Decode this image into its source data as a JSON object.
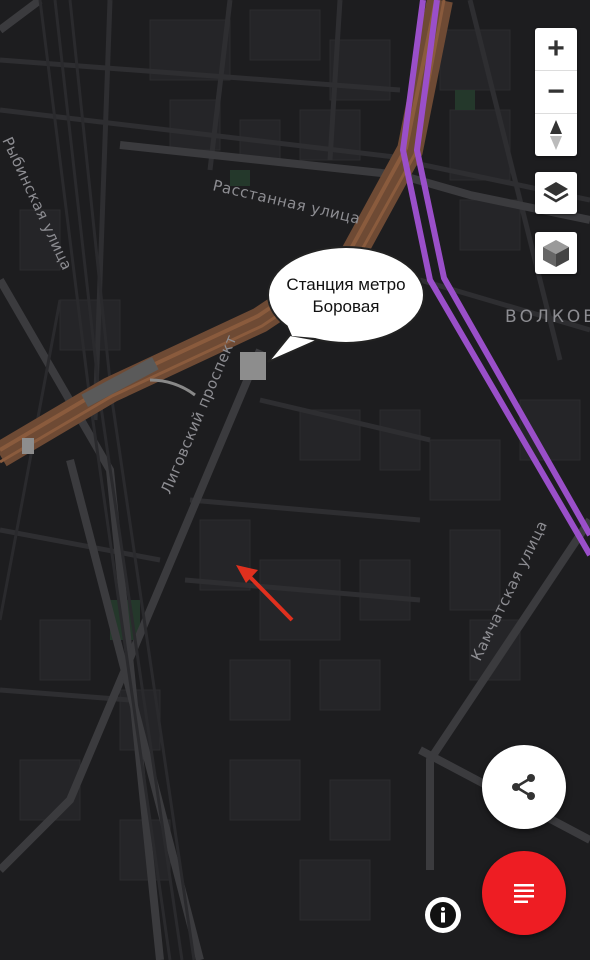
{
  "map": {
    "callout": {
      "line1": "Станция метро",
      "line2": "Боровая"
    },
    "streets": {
      "rasstannaya": "Расстанная улица",
      "ligovsky": "Лиговский проспект",
      "kamchatskaya": "Камчатская улица",
      "rybinskaya": "Рыбинская улица"
    },
    "district": "ВОЛКОВ",
    "colors": {
      "background": "#1d1d1f",
      "metro_line": "#9a4fc9",
      "highway": "#7a5238",
      "arrow": "#e0301e",
      "menu_button": "#ee1d23"
    }
  },
  "controls": {
    "zoom_in": "+",
    "zoom_out": "−",
    "compass_icon": "compass-icon",
    "layers_icon": "layers-icon",
    "three_d_icon": "cube-icon",
    "share_icon": "share-icon",
    "menu_icon": "list-icon",
    "info_icon": "info-icon"
  }
}
